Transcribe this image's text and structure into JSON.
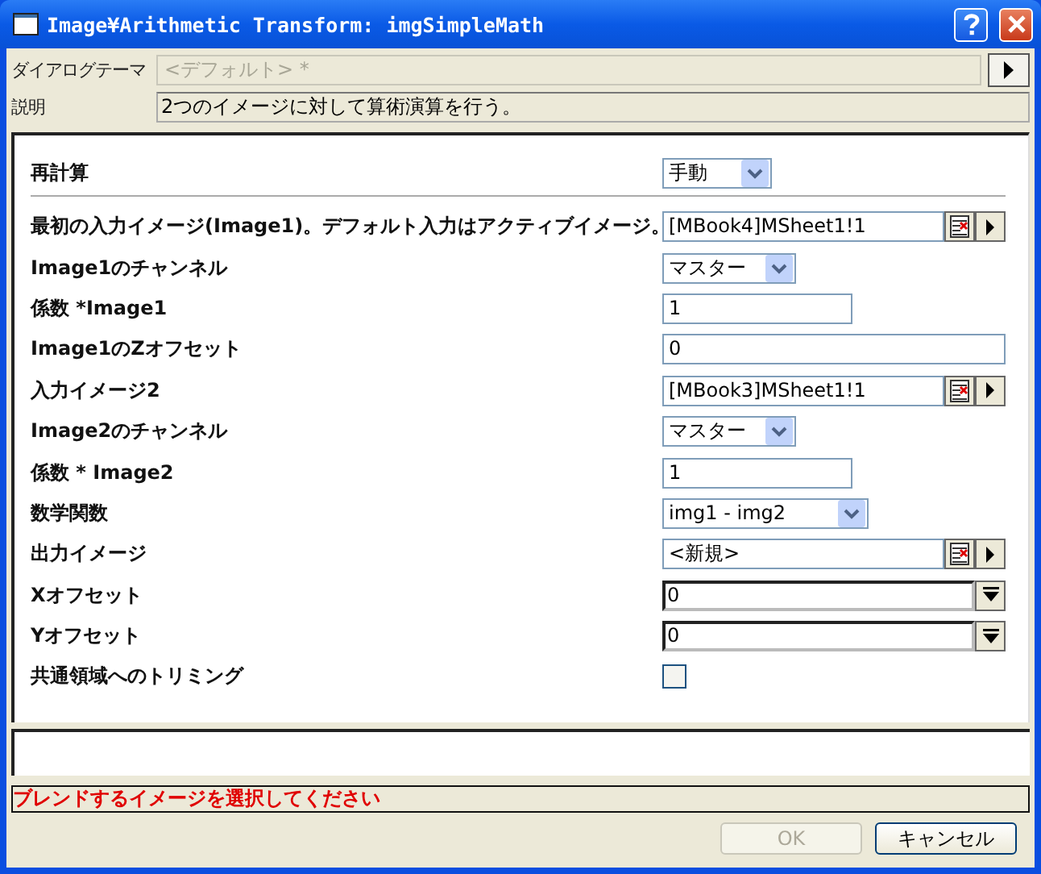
{
  "window": {
    "title": "Image¥Arithmetic Transform: imgSimpleMath"
  },
  "theme": {
    "label": "ダイアログテーマ",
    "value": "<デフォルト> *",
    "disabled": true
  },
  "description": {
    "label": "説明",
    "text": "2つのイメージに対して算術演算を行う。"
  },
  "recalculate": {
    "label": "再計算",
    "value": "手動"
  },
  "rows": [
    {
      "kind": "picker",
      "label": "最初の入力イメージ(Image1)。デフォルト入力はアクティブイメージ。",
      "value": "[MBook4]MSheet1!1"
    },
    {
      "kind": "combo",
      "label": "Image1のチャンネル",
      "value": "マスター"
    },
    {
      "kind": "text",
      "label": "係数 *Image1",
      "value": "1"
    },
    {
      "kind": "text",
      "label": "Image1のZオフセット",
      "value": "0"
    },
    {
      "kind": "picker",
      "label": "入力イメージ2",
      "value": "[MBook3]MSheet1!1"
    },
    {
      "kind": "combo",
      "label": "Image2のチャンネル",
      "value": "マスター"
    },
    {
      "kind": "text",
      "label": "係数 * Image2",
      "value": "1"
    },
    {
      "kind": "combo",
      "label": "数学関数",
      "value": "img1 - img2"
    },
    {
      "kind": "picker",
      "label": "出力イメージ",
      "value": "<新規>"
    },
    {
      "kind": "spin",
      "label": "Xオフセット",
      "value": "0"
    },
    {
      "kind": "spin",
      "label": "Yオフセット",
      "value": "0"
    },
    {
      "kind": "checkbox",
      "label": "共通領域へのトリミング",
      "checked": false
    }
  ],
  "status": "ブレンドするイメージを選択してください",
  "buttons": [
    {
      "label": "OK",
      "disabled": true
    },
    {
      "label": "キャンセル",
      "disabled": false
    }
  ]
}
